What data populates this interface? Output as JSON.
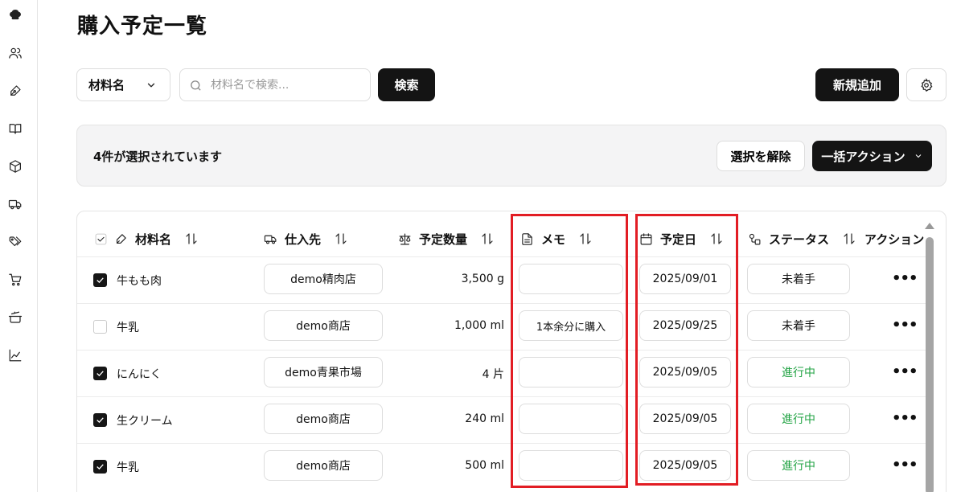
{
  "page": {
    "title": "購入予定一覧"
  },
  "sidebar": {
    "icons": [
      "chef-hat-icon",
      "users-icon",
      "pen-icon",
      "book-icon",
      "package-icon",
      "truck-icon",
      "tags-icon",
      "cart-icon",
      "cooking-pot-icon",
      "chart-line-icon"
    ]
  },
  "toolbar": {
    "filter_field": "材料名",
    "search_placeholder": "材料名で検索...",
    "search_value": "",
    "search_button": "検索",
    "add_button": "新規追加"
  },
  "selection_bar": {
    "text": "4件が選択されています",
    "clear_button": "選択を解除",
    "bulk_action_button": "一括アクション"
  },
  "table": {
    "columns": {
      "material": "材料名",
      "supplier": "仕入先",
      "quantity": "予定数量",
      "memo": "メモ",
      "date": "予定日",
      "status": "ステータス",
      "actions": "アクション"
    },
    "rows": [
      {
        "checked": true,
        "material": "牛もも肉",
        "supplier": "demo精肉店",
        "quantity": "3,500 g",
        "memo": "",
        "date": "2025/09/01",
        "status": "未着手"
      },
      {
        "checked": false,
        "material": "牛乳",
        "supplier": "demo商店",
        "quantity": "1,000 ml",
        "memo": "1本余分に購入",
        "date": "2025/09/25",
        "status": "未着手"
      },
      {
        "checked": true,
        "material": "にんにく",
        "supplier": "demo青果市場",
        "quantity": "4 片",
        "memo": "",
        "date": "2025/09/05",
        "status": "進行中"
      },
      {
        "checked": true,
        "material": "生クリーム",
        "supplier": "demo商店",
        "quantity": "240 ml",
        "memo": "",
        "date": "2025/09/05",
        "status": "進行中"
      },
      {
        "checked": true,
        "material": "牛乳",
        "supplier": "demo商店",
        "quantity": "500 ml",
        "memo": "",
        "date": "2025/09/05",
        "status": "進行中"
      }
    ],
    "more_label": "•••"
  },
  "colors": {
    "accent_dark": "#141414",
    "status_in_progress": "#22a344",
    "highlight": "#e21d24"
  }
}
